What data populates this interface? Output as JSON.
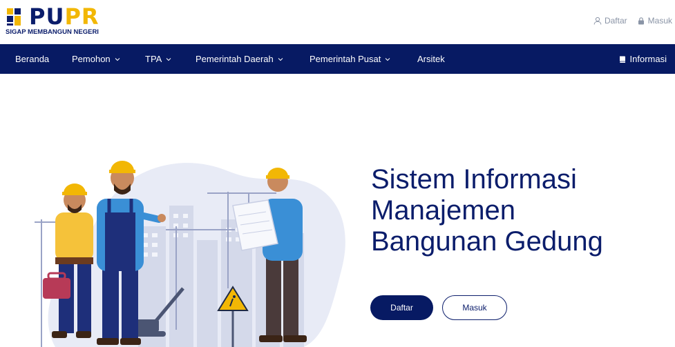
{
  "brand": {
    "logo_text_main": "PU",
    "logo_text_accent": "PR",
    "tagline": "SIGAP MEMBANGUN NEGERI"
  },
  "auth": {
    "register_label": "Daftar",
    "login_label": "Masuk"
  },
  "nav": {
    "items": [
      {
        "label": "Beranda",
        "dropdown": false
      },
      {
        "label": "Pemohon",
        "dropdown": true
      },
      {
        "label": "TPA",
        "dropdown": true
      },
      {
        "label": "Pemerintah Daerah",
        "dropdown": true
      },
      {
        "label": "Pemerintah Pusat",
        "dropdown": true
      },
      {
        "label": "Arsitek",
        "dropdown": false
      }
    ],
    "info_label": "Informasi"
  },
  "hero": {
    "title_lines": [
      "Sistem Informasi",
      "Manajemen",
      "Bangunan Gedung"
    ],
    "primary_button": "Daftar",
    "secondary_button": "Masuk"
  },
  "colors": {
    "navy": "#071a63",
    "brand_blue": "#0b1d6b",
    "brand_yellow": "#f2b705"
  },
  "icons": {
    "user": "user-icon",
    "lock": "lock-icon",
    "book": "book-icon",
    "chevron": "chevron-down-icon"
  }
}
